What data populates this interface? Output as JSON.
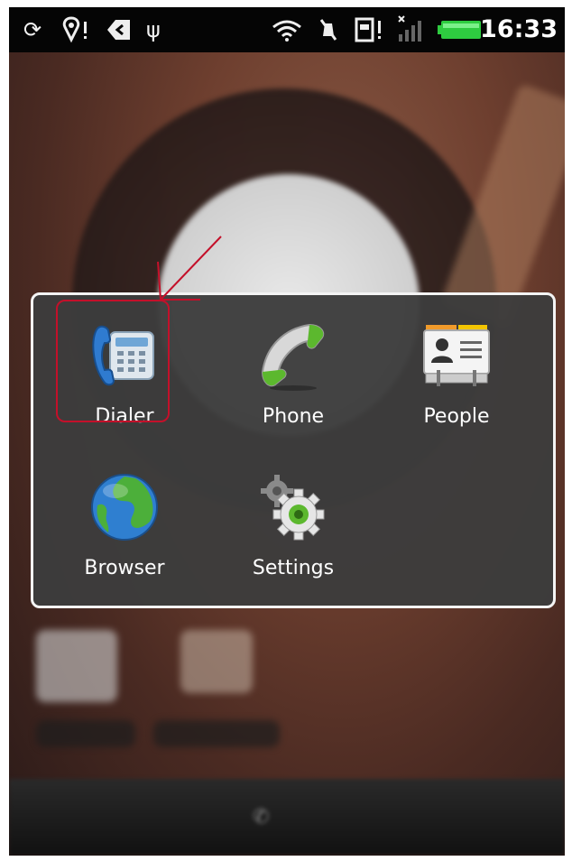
{
  "status_bar": {
    "time": "16:33",
    "icons": [
      "sync-icon",
      "location-alert-icon",
      "back-badge-icon",
      "usb-icon",
      "wifi-icon",
      "vibrate-off-icon",
      "sd-card-alert-icon",
      "no-signal-icon",
      "battery-icon"
    ]
  },
  "folder": {
    "apps": [
      {
        "label": "Dialer",
        "icon": "dialer-icon"
      },
      {
        "label": "Phone",
        "icon": "phone-icon"
      },
      {
        "label": "People",
        "icon": "people-icon"
      },
      {
        "label": "Browser",
        "icon": "browser-icon"
      },
      {
        "label": "Settings",
        "icon": "settings-icon"
      }
    ]
  },
  "colors": {
    "highlight": "#c4102a",
    "panel_border": "#f4f4f4",
    "battery": "#2ecc40"
  }
}
